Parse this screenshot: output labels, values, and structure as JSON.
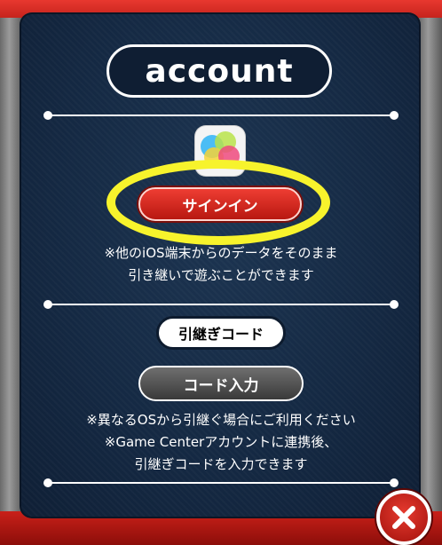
{
  "dialog": {
    "title": "account",
    "signin_button": "サインイン",
    "signin_note_line1": "※他のiOS端末からのデータをそのまま",
    "signin_note_line2": "引き継いで遊ぶことができます",
    "transfer_code_label": "引継ぎコード",
    "code_input_button": "コード入力",
    "transfer_note_line1": "※異なるOSから引継ぐ場合にご利用ください",
    "transfer_note_line2": "※Game Centerアカウントに連携後、",
    "transfer_note_line3": "引継ぎコードを入力できます"
  },
  "icons": {
    "game_center": "game-center-icon",
    "close": "close-icon"
  },
  "colors": {
    "frame_red": "#c92019",
    "panel_navy": "#142842",
    "highlight_yellow": "#f7f32c",
    "signin_red": "#d32a21",
    "code_gray": "#555555"
  }
}
